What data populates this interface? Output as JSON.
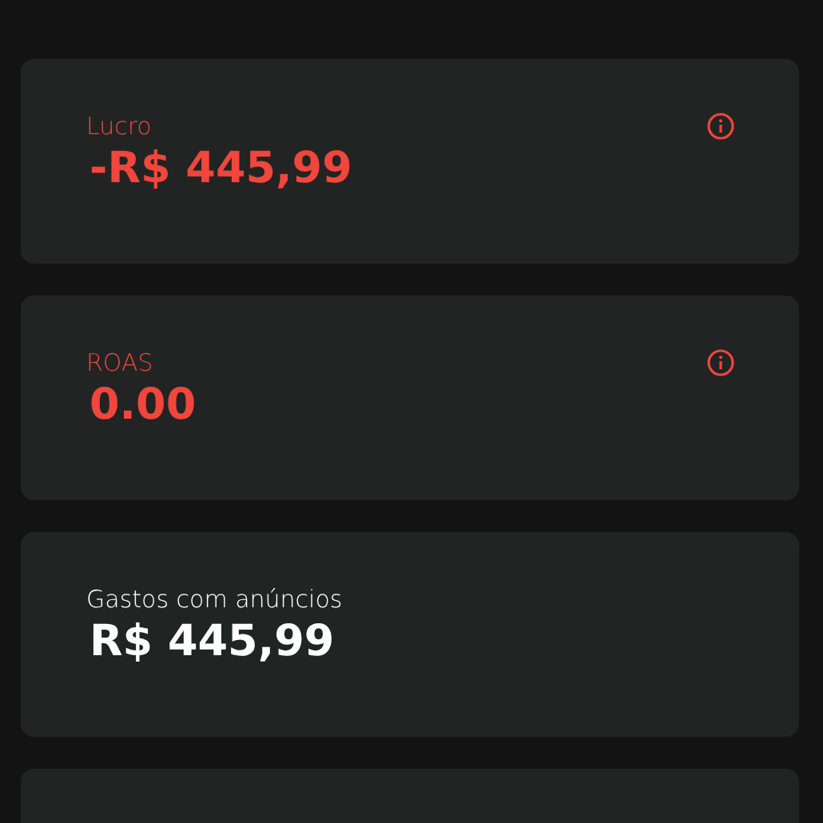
{
  "cards": [
    {
      "label": "Lucro",
      "value": "-R$ 445,99",
      "color": "#f0463c",
      "info": true
    },
    {
      "label": "ROAS",
      "value": "0.00",
      "color": "#f0463c",
      "info": true
    },
    {
      "label": "Gastos com anúncios",
      "value": "R$ 445,99",
      "color": "#ffffff",
      "info": false
    }
  ]
}
